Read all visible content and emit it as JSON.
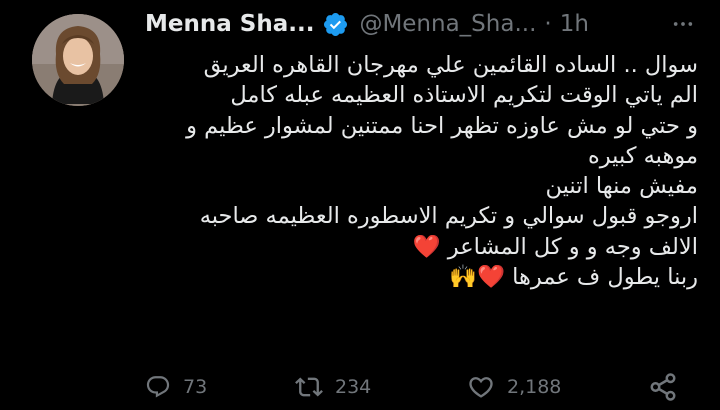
{
  "author": {
    "name": "Menna Sha...",
    "handle": "@Menna_Sha...",
    "separator": "·",
    "time": "1h",
    "verified_color": "#1d9bf0"
  },
  "icons": {
    "verified": "verified-badge-icon",
    "more": "more-options-icon",
    "reply": "reply-icon",
    "retweet": "retweet-icon",
    "like": "heart-icon",
    "share": "share-icon"
  },
  "tweet": {
    "lines": [
      "سوال .. الساده القائمين علي مهرجان القاهره العريق",
      "الم ياتي الوقت لتكريم الاستاذه العظيمه عبله كامل",
      "و حتي لو مش عاوزه تظهر احنا ممتنين لمشوار عظيم و",
      "موهبه كبيره",
      "مفيش منها اتنين",
      "اروجو قبول سوالي و تكريم الاسطوره العظيمه صاحبه",
      "الالف وجه و و كل المشاعر ❤️",
      "ربنا يطول ف عمرها ❤️🙌"
    ]
  },
  "stats": {
    "replies": "73",
    "retweets": "234",
    "likes": "2,188"
  },
  "colors": {
    "background": "#000000",
    "text": "#e7e9ea",
    "muted": "#71767b",
    "accent": "#1d9bf0"
  }
}
